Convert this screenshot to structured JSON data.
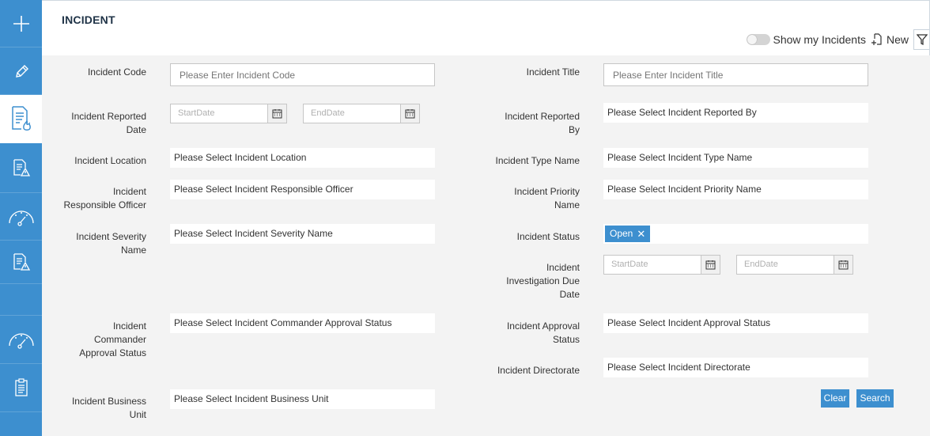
{
  "sidebar": {
    "items": [
      {
        "icon": "plus-icon"
      },
      {
        "icon": "pencil-icon"
      },
      {
        "icon": "incident-document-icon",
        "active": true
      },
      {
        "icon": "document-warning-icon"
      },
      {
        "icon": "gauge-icon"
      },
      {
        "icon": "document-warning-icon"
      },
      {
        "icon": "blank"
      },
      {
        "icon": "gauge-icon"
      },
      {
        "icon": "clipboard-icon"
      }
    ]
  },
  "header": {
    "title": "INCIDENT",
    "show_my_incidents_label": "Show my Incidents",
    "show_my_incidents_on": false,
    "new_label": "New"
  },
  "form": {
    "incident_code": {
      "label": "Incident Code",
      "placeholder": "Please Enter Incident Code",
      "value": ""
    },
    "incident_title": {
      "label": "Incident Title",
      "placeholder": "Please Enter Incident Title",
      "value": ""
    },
    "reported_date": {
      "label_1": "Incident Reported",
      "label_2": "Date",
      "start_placeholder": "StartDate",
      "end_placeholder": "EndDate"
    },
    "reported_by": {
      "label_1": "Incident Reported",
      "label_2": "By",
      "placeholder": "Please Select Incident Reported By"
    },
    "location": {
      "label": "Incident Location",
      "placeholder": "Please Select Incident Location"
    },
    "type_name": {
      "label": "Incident Type Name",
      "placeholder": "Please Select Incident Type Name"
    },
    "responsible_officer": {
      "label_1": "Incident",
      "label_2": "Responsible Officer",
      "placeholder": "Please Select Incident Responsible Officer"
    },
    "priority_name": {
      "label_1": "Incident Priority",
      "label_2": "Name",
      "placeholder": "Please Select Incident Priority Name"
    },
    "severity_name": {
      "label_1": "Incident Severity",
      "label_2": "Name",
      "placeholder": "Please Select Incident Severity Name"
    },
    "status": {
      "label": "Incident Status",
      "selected": "Open",
      "remove_glyph": "✕"
    },
    "investigation_due_date": {
      "label_1": "Incident",
      "label_2": "Investigation Due",
      "label_3": "Date",
      "start_placeholder": "StartDate",
      "end_placeholder": "EndDate"
    },
    "commander_approval": {
      "label_1": "Incident",
      "label_2": "Commander",
      "label_3": "Approval Status",
      "placeholder": "Please Select Incident Commander Approval Status"
    },
    "approval_status": {
      "label_1": "Incident Approval",
      "label_2": "Status",
      "placeholder": "Please Select Incident Approval Status"
    },
    "directorate": {
      "label": "Incident Directorate",
      "placeholder": "Please Select Incident Directorate"
    },
    "business_unit": {
      "label_1": "Incident Business",
      "label_2": "Unit",
      "placeholder": "Please Select Incident Business Unit"
    }
  },
  "buttons": {
    "clear": "Clear",
    "search": "Search"
  },
  "colors": {
    "accent": "#3d8fcf",
    "form_background": "#f3f3f3"
  }
}
